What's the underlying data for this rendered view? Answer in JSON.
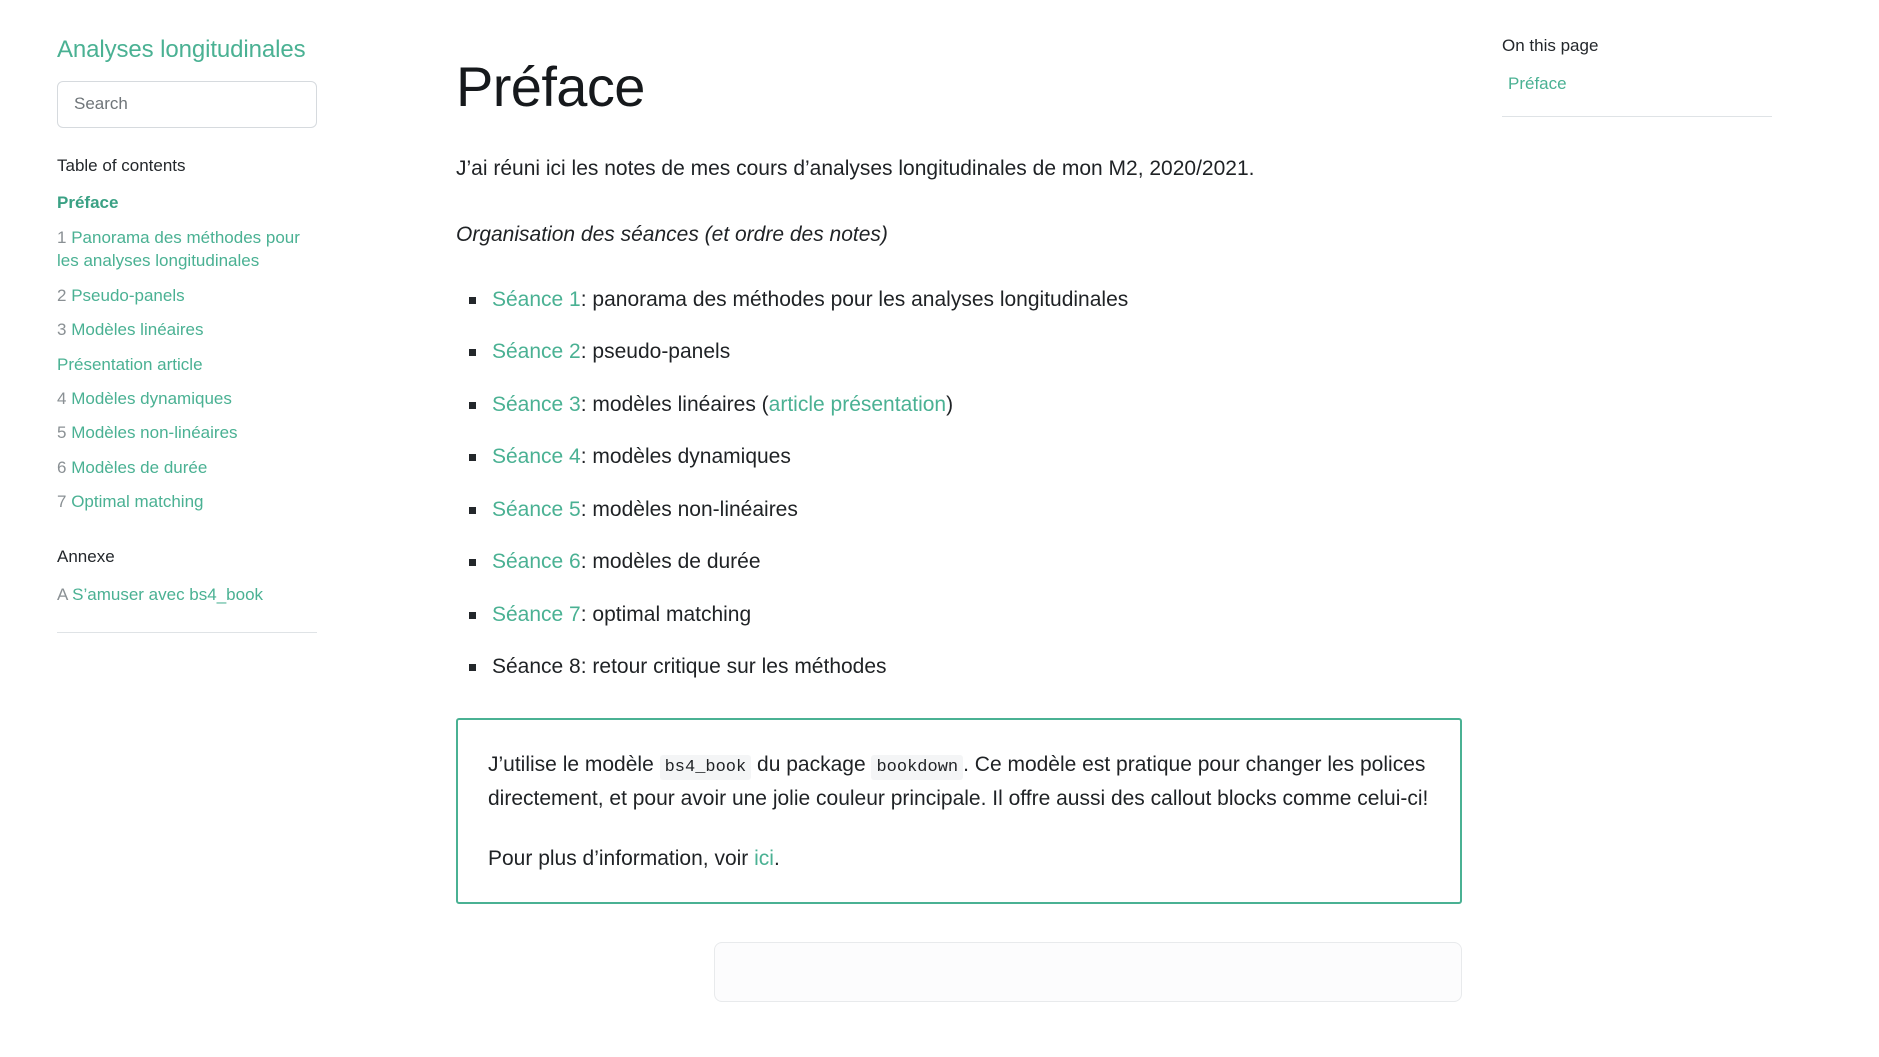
{
  "theme": {
    "accent": "#4ab193",
    "text": "#1f2225",
    "muted": "#8a9094",
    "border": "#dfe3e6"
  },
  "sidebar": {
    "book_title": "Analyses longitudinales",
    "search": {
      "placeholder": "Search",
      "value": ""
    },
    "toc_heading": "Table of contents",
    "toc_items": [
      {
        "num": "",
        "label": "Préface",
        "active": true
      },
      {
        "num": "1",
        "label": "Panorama des méthodes pour les analyses longitudinales",
        "active": false
      },
      {
        "num": "2",
        "label": "Pseudo-panels",
        "active": false
      },
      {
        "num": "3",
        "label": "Modèles linéaires",
        "active": false
      },
      {
        "num": "",
        "label": "Présentation article",
        "active": false
      },
      {
        "num": "4",
        "label": "Modèles dynamiques",
        "active": false
      },
      {
        "num": "5",
        "label": "Modèles non-linéaires",
        "active": false
      },
      {
        "num": "6",
        "label": "Modèles de durée",
        "active": false
      },
      {
        "num": "7",
        "label": "Optimal matching",
        "active": false
      }
    ],
    "annexe_heading": "Annexe",
    "annexe_items": [
      {
        "num": "A",
        "label": "S’amuser avec bs4_book"
      }
    ]
  },
  "main": {
    "title": "Préface",
    "intro": "J’ai réuni ici les notes de mes cours d’analyses longitudinales de mon M2, 2020/2021.",
    "subhead": "Organisation des séances (et ordre des notes)",
    "seances": [
      {
        "link": "Séance 1",
        "rest": ": panorama des méthodes pour les analyses longitudinales",
        "extra_prefix": "",
        "extra_link": "",
        "extra_suffix": ""
      },
      {
        "link": "Séance 2",
        "rest": ": pseudo-panels",
        "extra_prefix": "",
        "extra_link": "",
        "extra_suffix": ""
      },
      {
        "link": "Séance 3",
        "rest": ": modèles linéaires ",
        "extra_prefix": "(",
        "extra_link": "article présentation",
        "extra_suffix": ")"
      },
      {
        "link": "Séance 4",
        "rest": ": modèles dynamiques",
        "extra_prefix": "",
        "extra_link": "",
        "extra_suffix": ""
      },
      {
        "link": "Séance 5",
        "rest": ": modèles non-linéaires",
        "extra_prefix": "",
        "extra_link": "",
        "extra_suffix": ""
      },
      {
        "link": "Séance 6",
        "rest": ": modèles de durée",
        "extra_prefix": "",
        "extra_link": "",
        "extra_suffix": ""
      },
      {
        "link": "Séance 7",
        "rest": ": optimal matching",
        "extra_prefix": "",
        "extra_link": "",
        "extra_suffix": ""
      },
      {
        "link": "",
        "rest": "Séance 8: retour critique sur les méthodes",
        "extra_prefix": "",
        "extra_link": "",
        "extra_suffix": ""
      }
    ],
    "callout": {
      "p1_a": "J’utilise le modèle ",
      "p1_code1": "bs4_book",
      "p1_b": " du package ",
      "p1_code2": "bookdown",
      "p1_c": ". Ce modèle est pratique pour changer les polices directement, et pour avoir une jolie couleur principale. Il offre aussi des callout blocks comme celui-ci!",
      "p2_a": "Pour plus d’information, voir ",
      "p2_link": "ici",
      "p2_b": "."
    }
  },
  "rightbar": {
    "heading": "On this page",
    "items": [
      {
        "label": "Préface"
      }
    ]
  }
}
